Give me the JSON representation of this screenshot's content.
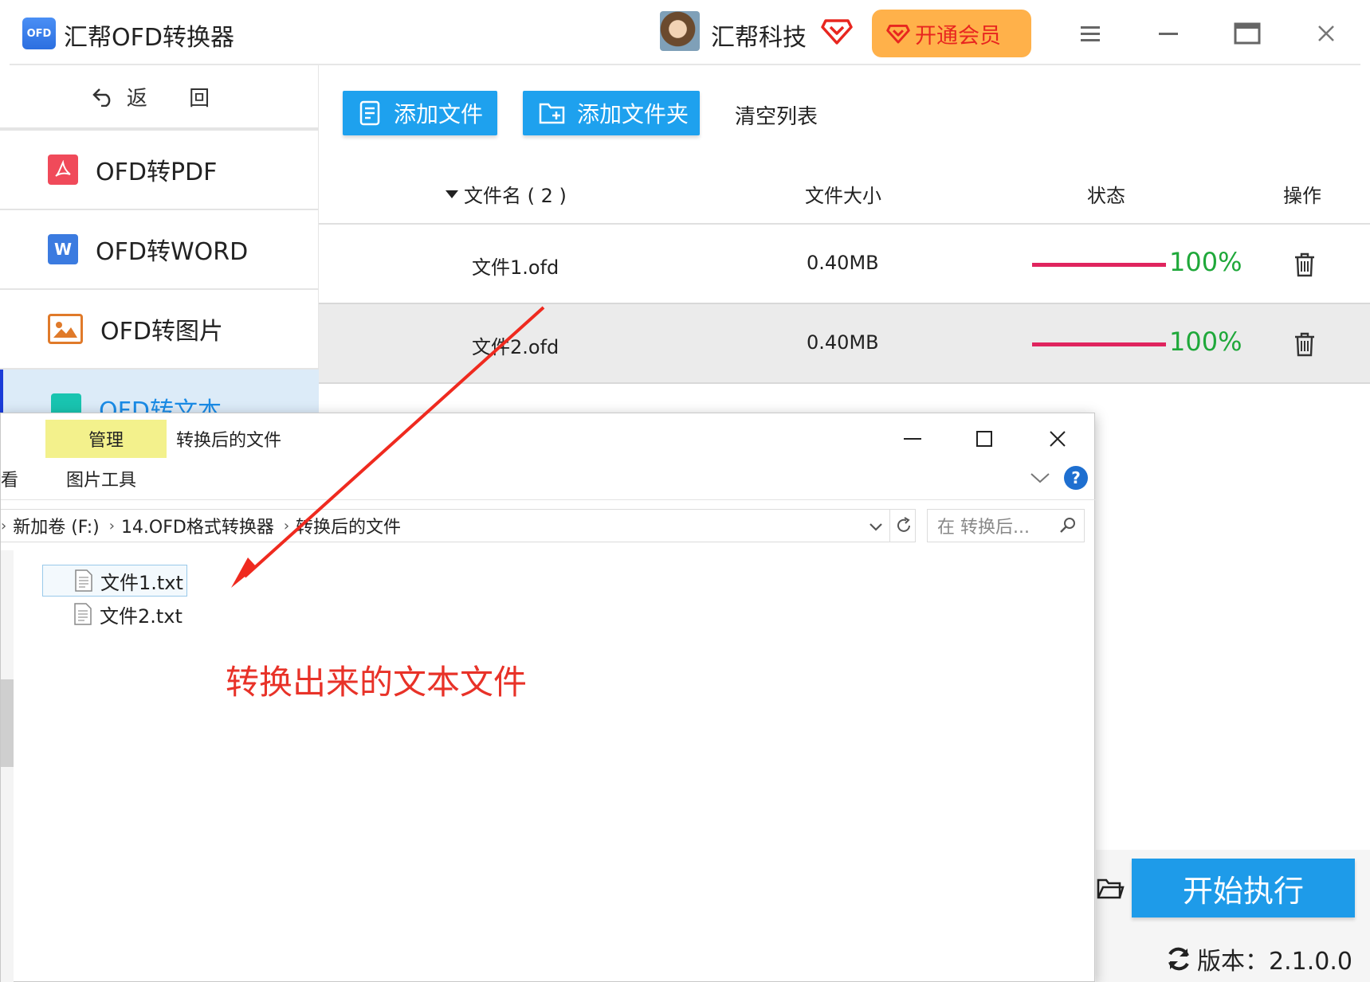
{
  "titlebar": {
    "logo_text": "OFD",
    "app_title": "汇帮OFD转换器",
    "company": "汇帮科技",
    "vip_label": "开通会员"
  },
  "sidebar": {
    "back_label": "返 回",
    "items": [
      {
        "label": "OFD转PDF",
        "icon": "pdf-icon",
        "color": "#f04a5a"
      },
      {
        "label": "OFD转WORD",
        "icon": "word-icon",
        "color": "#3b7be0"
      },
      {
        "label": "OFD转图片",
        "icon": "image-icon",
        "color": "#e07a2a"
      },
      {
        "label": "OFD转文本",
        "icon": "text-icon",
        "color": "#19c4b0"
      }
    ]
  },
  "toolbar": {
    "add_file": "添加文件",
    "add_folder": "添加文件夹",
    "clear_list": "清空列表"
  },
  "table": {
    "headers": {
      "name": "文件名 ( 2 )",
      "size": "文件大小",
      "status": "状态",
      "action": "操作"
    },
    "rows": [
      {
        "name": "文件1.ofd",
        "size": "0.40MB",
        "progress": "100%",
        "progress_value": 1.0
      },
      {
        "name": "文件2.ofd",
        "size": "0.40MB",
        "progress": "100%",
        "progress_value": 1.0
      }
    ]
  },
  "bottom": {
    "start_label": "开始执行",
    "version_label": "版本：2.1.0.0"
  },
  "explorer": {
    "tab_manage": "管理",
    "title": "转换后的文件",
    "tab_view_partial": "看",
    "tab_picture_tools": "图片工具",
    "breadcrumb": [
      "新加卷 (F:)",
      "14.OFD格式转换器",
      "转换后的文件"
    ],
    "search_placeholder": "在 转换后...",
    "help": "?",
    "files": [
      "文件1.txt",
      "文件2.txt"
    ],
    "annotation": "转换出来的文本文件"
  },
  "colors": {
    "accent": "#1ea1ee",
    "vip": "#ffb14a",
    "progress": "#e0245e",
    "percent": "#1fa83a",
    "annotation": "#e83228"
  }
}
